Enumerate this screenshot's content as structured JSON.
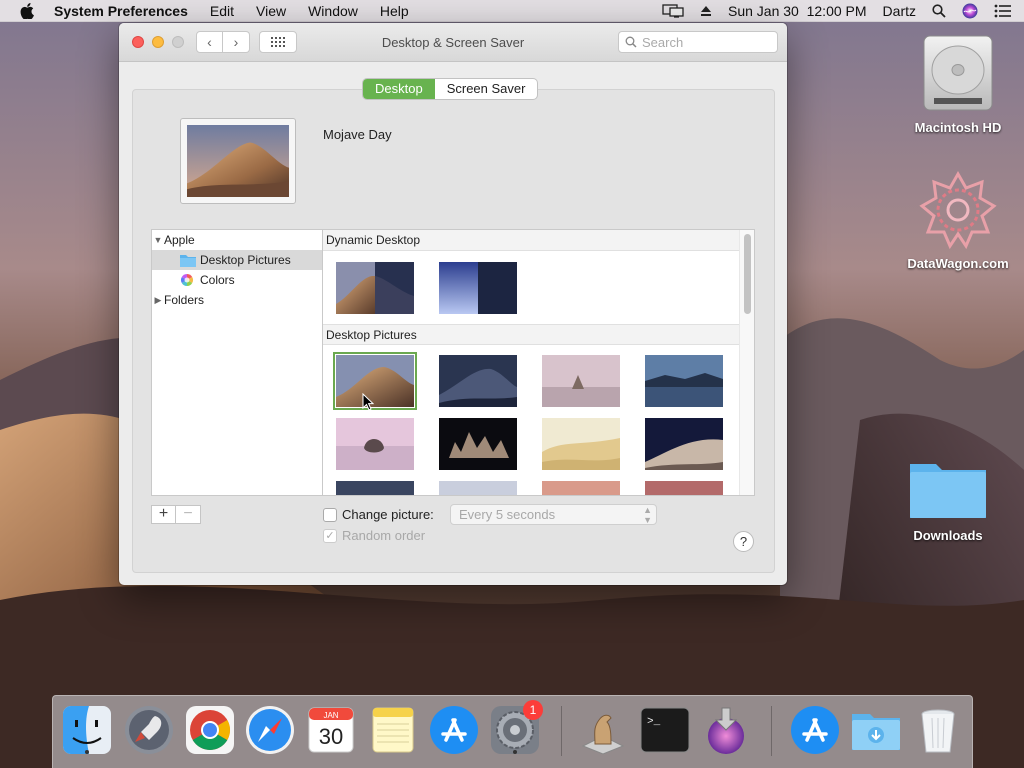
{
  "menubar": {
    "app_name": "System Preferences",
    "menus": [
      "Edit",
      "View",
      "Window",
      "Help"
    ],
    "datetime": "Sun Jan 30  12:00 PM",
    "user": "Dartz"
  },
  "desktop_icons": {
    "hd": "Macintosh HD",
    "site": "DataWagon.com",
    "downloads": "Downloads"
  },
  "window": {
    "title": "Desktop & Screen Saver",
    "search_placeholder": "Search",
    "tabs": {
      "desktop": "Desktop",
      "screensaver": "Screen Saver"
    },
    "current_picture": "Mojave Day",
    "sources": {
      "apple": "Apple",
      "desktop_pictures": "Desktop Pictures",
      "colors": "Colors",
      "folders": "Folders"
    },
    "groups": {
      "dynamic": "Dynamic Desktop",
      "pictures": "Desktop Pictures"
    },
    "add_label": "+",
    "remove_label": "−",
    "change_picture_label": "Change picture:",
    "interval_value": "Every 5 seconds",
    "random_label": "Random order",
    "help_label": "?"
  },
  "dock": {
    "calendar_month": "JAN",
    "calendar_day": "30",
    "prefs_badge": "1",
    "terminal_prompt": ">_"
  },
  "colors": {
    "accent_green": "#68b34f",
    "selection_green": "#6aa84f",
    "badge_red": "#fc3d39"
  }
}
